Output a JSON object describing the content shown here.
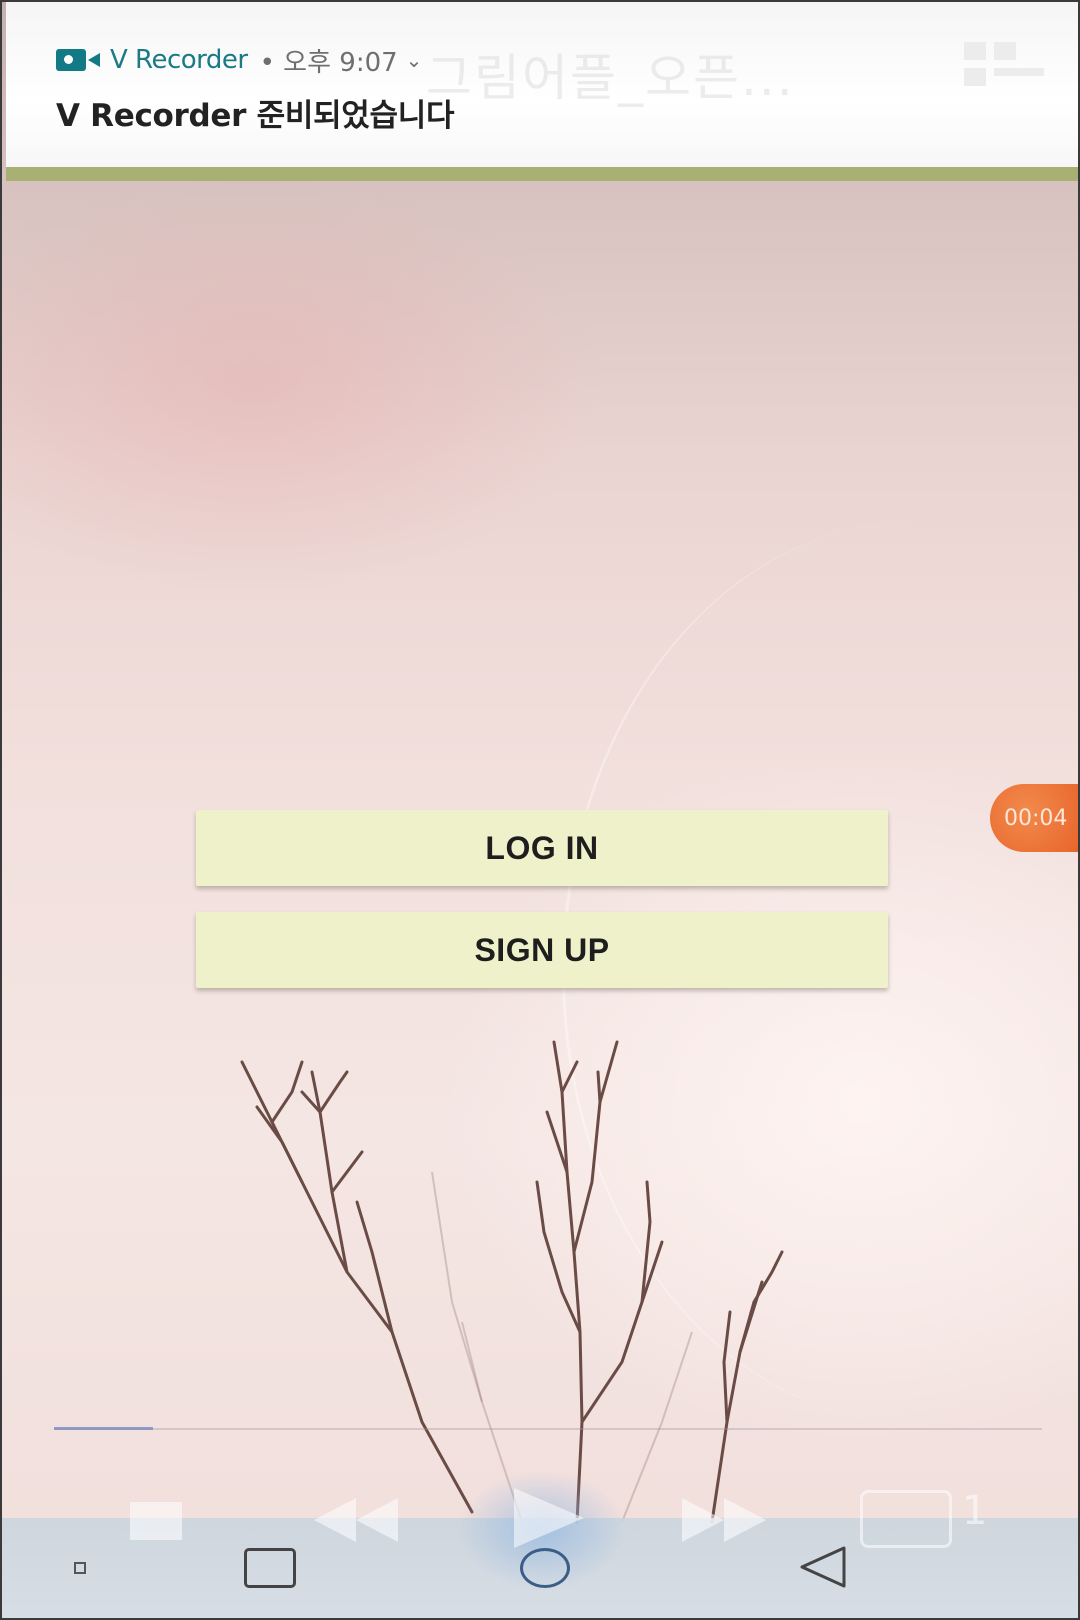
{
  "notification": {
    "app_name": "V Recorder",
    "time": "• 오후 9:07",
    "chevron": "⌄",
    "message": "V Recorder 준비되었습니다",
    "ghost_title": "그림어플_오픈...",
    "app_icon": "video-camera-icon",
    "grid_icon": "grid-icon"
  },
  "buttons": {
    "login_label": "LOG IN",
    "signup_label": "SIGN UP"
  },
  "recorder": {
    "timer": "00:04",
    "seek_progress": 0.1
  },
  "media_controls": {
    "icons": [
      "stop-icon",
      "rewind-icon",
      "play-icon",
      "fast-forward-icon",
      "quality-icon"
    ],
    "speed_label": "1"
  },
  "nav_bar": {
    "icons": [
      "small-square-icon",
      "recent-apps-icon",
      "home-icon",
      "back-icon"
    ]
  },
  "colors": {
    "button_bg": "#eef1c9",
    "notification_accent": "#a9b073",
    "app_name": "#1a7a85",
    "timer_bubble": "#e8642b"
  }
}
